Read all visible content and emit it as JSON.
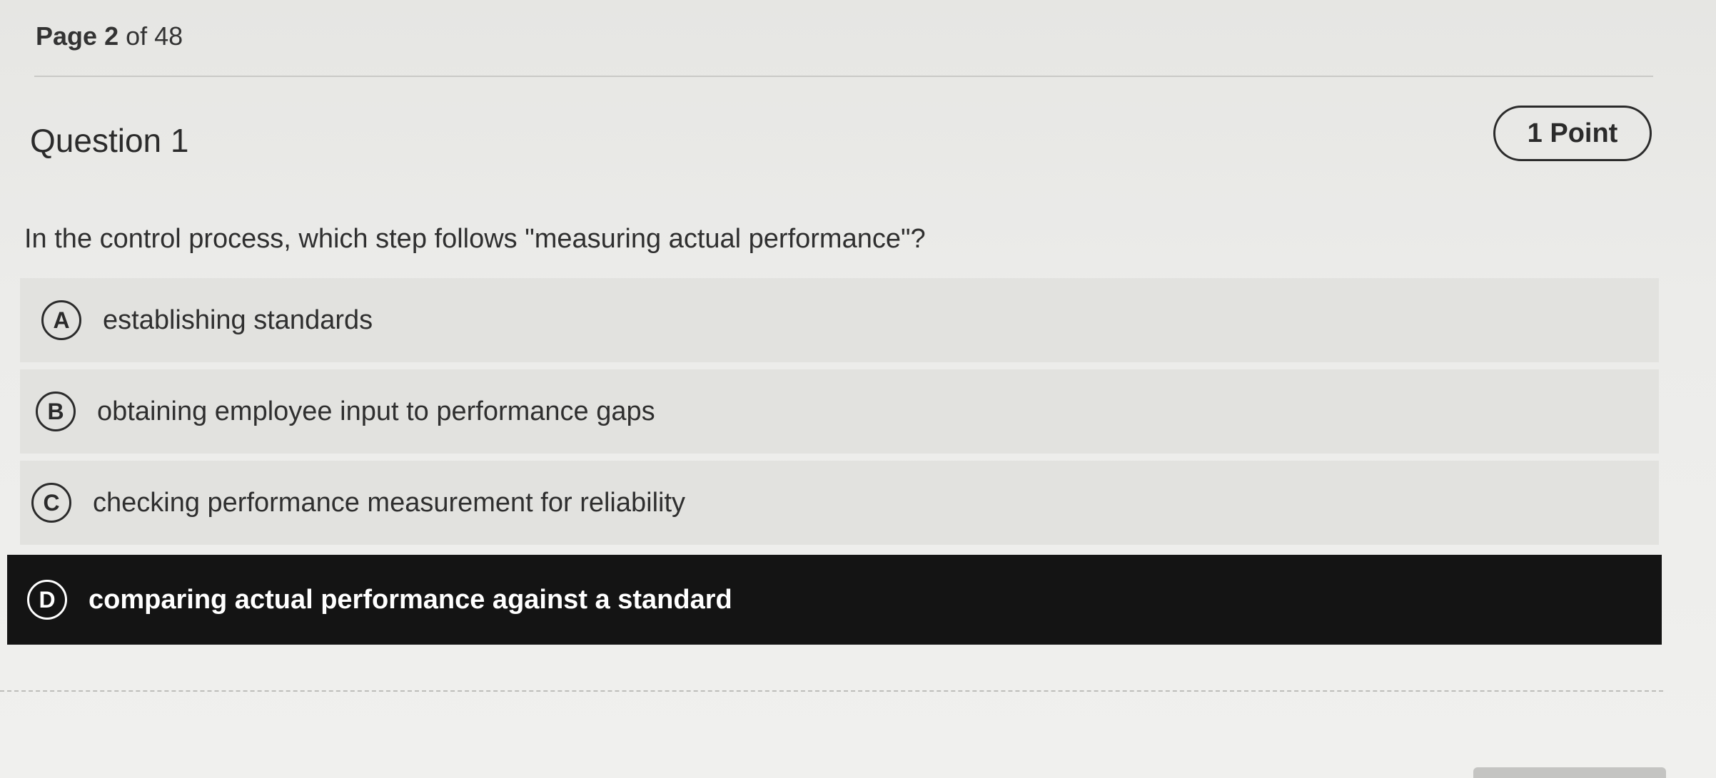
{
  "header": {
    "page_word": "Page",
    "page_current": "2",
    "page_of": "of 48"
  },
  "question": {
    "title": "Question 1",
    "points": "1 Point",
    "text": "In the control process, which step follows \"measuring actual performance\"?"
  },
  "choices": [
    {
      "letter": "A",
      "label": "establishing standards",
      "selected": false
    },
    {
      "letter": "B",
      "label": "obtaining employee input to performance gaps",
      "selected": false
    },
    {
      "letter": "C",
      "label": "checking performance measurement for reliability",
      "selected": false
    },
    {
      "letter": "D",
      "label": "comparing actual performance against a standard",
      "selected": true
    }
  ],
  "colors": {
    "selected_background": "#141414",
    "choice_background": "#e2e2df",
    "page_background": "#ececea"
  }
}
